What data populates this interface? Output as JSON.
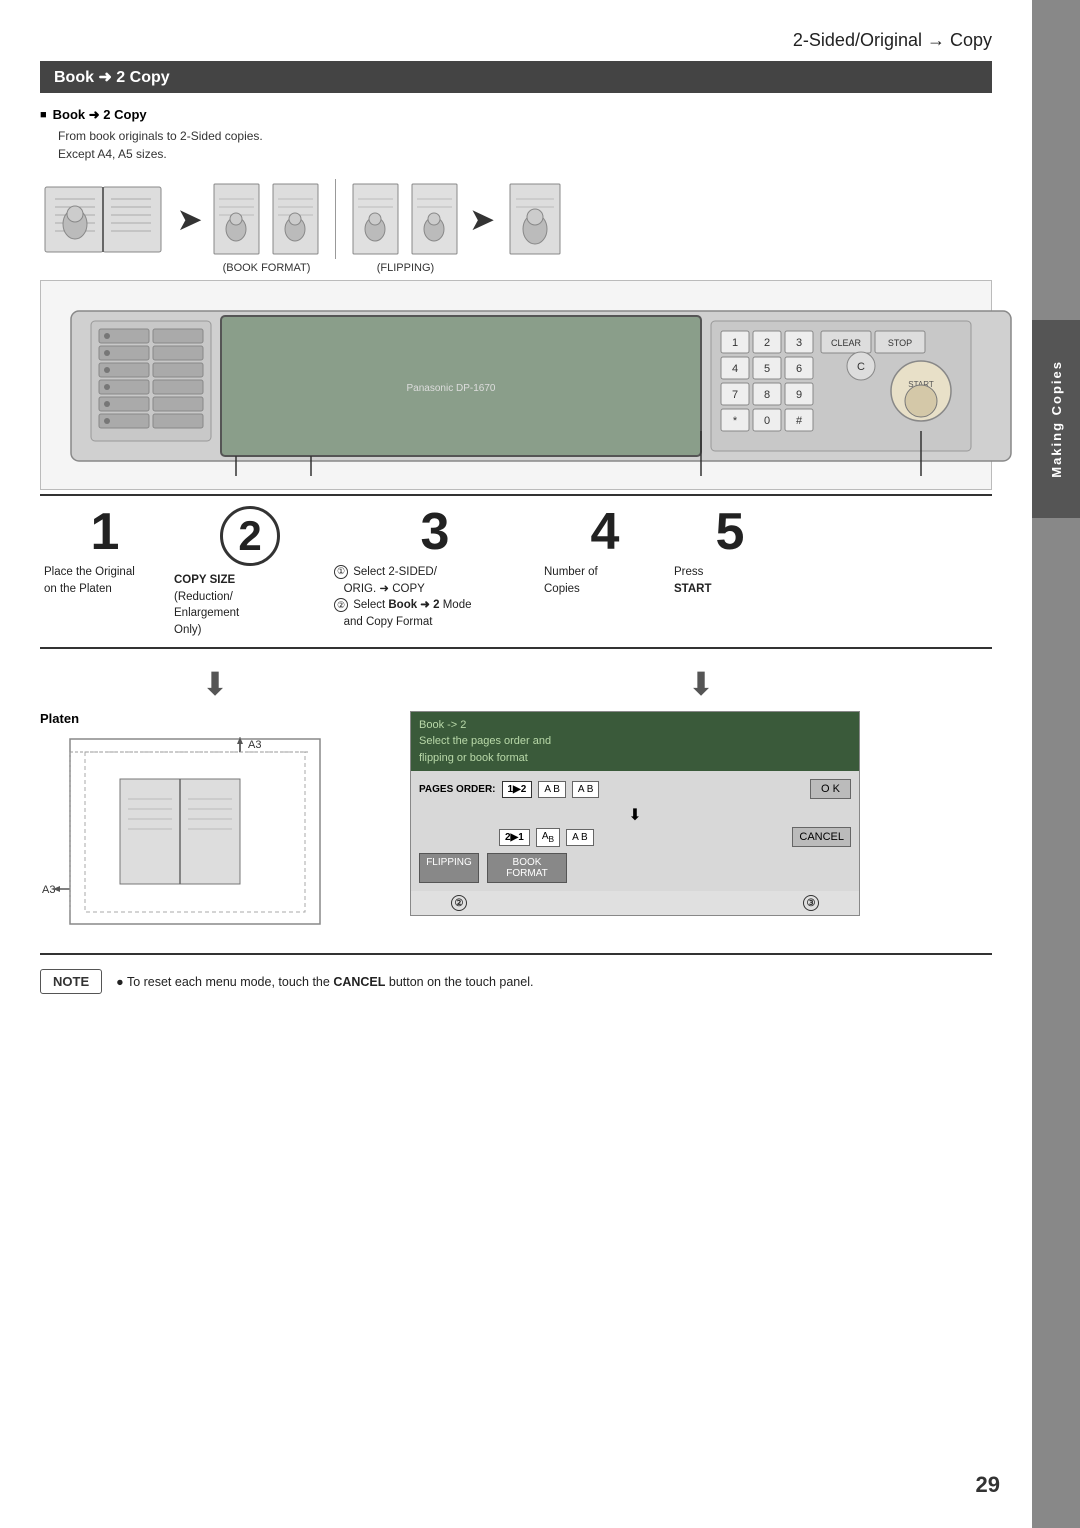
{
  "page": {
    "title": "2-Sided/Original → Copy",
    "section_title": "Book → 2 Copy",
    "page_number": "29",
    "tab_label": "Making Copies"
  },
  "subsection": {
    "heading": "Book → 2 Copy",
    "desc_line1": "From book originals to 2-Sided copies.",
    "desc_line2": "Except A4, A5 sizes."
  },
  "flow": {
    "label_book_format": "(BOOK FORMAT)",
    "label_flipping": "(FLIPPING)"
  },
  "steps": [
    {
      "number": "1",
      "style": "plain",
      "desc": "Place the Original\non the Platen"
    },
    {
      "number": "2",
      "style": "circle",
      "desc_bold": "COPY SIZE",
      "desc": "(Reduction/\nEnlargement\nOnly)"
    },
    {
      "number": "3",
      "style": "plain",
      "desc": "① Select 2-SIDED/\nORIG. → COPY\n② Select Book → 2 Mode\nand Copy Format"
    },
    {
      "number": "4",
      "style": "plain",
      "desc": "Number of\nCopies"
    },
    {
      "number": "5",
      "style": "plain",
      "desc": "Press\nSTART"
    }
  ],
  "platen": {
    "label": "Platen",
    "dim_top": "A3",
    "dim_left": "A3"
  },
  "screen": {
    "header_line1": "Book -> 2",
    "header_line2": "Select the pages order and",
    "header_line3": "flipping or book format",
    "pages_order_label": "PAGES ORDER:",
    "ok_label": "O K",
    "cancel_label": "CANCEL",
    "flipping_label": "FLIPPING",
    "book_format_label": "BOOK FORMAT",
    "circle2": "②",
    "circle3": "③"
  },
  "note": {
    "label": "NOTE",
    "text": "To reset each menu mode, touch the ",
    "bold_text": "CANCEL",
    "text_after": " button on the touch panel."
  }
}
